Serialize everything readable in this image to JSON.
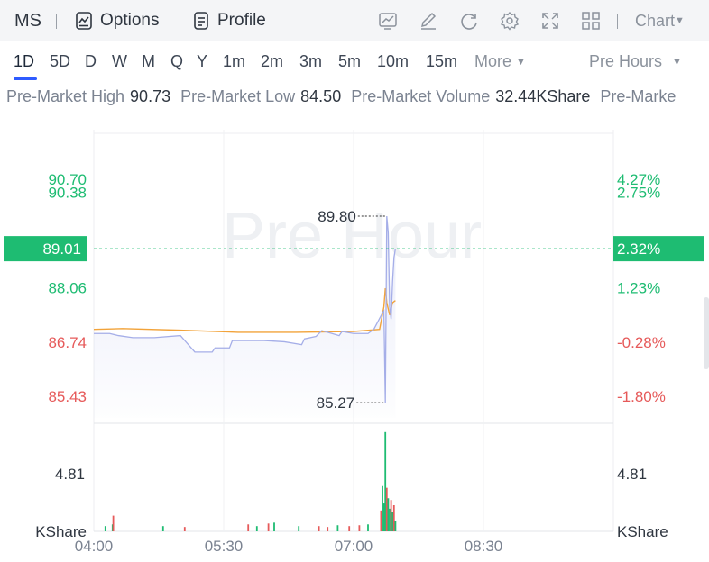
{
  "toolbar": {
    "symbol": "MS",
    "options_label": "Options",
    "profile_label": "Profile",
    "chart_label": "Chart",
    "icons": [
      "options-icon",
      "profile-icon",
      "indicator-icon",
      "draw-icon",
      "refresh-icon",
      "settings-icon",
      "fullscreen-icon",
      "layout-grid-icon"
    ]
  },
  "timeframes": {
    "items": [
      "1D",
      "5D",
      "D",
      "W",
      "M",
      "Q",
      "Y",
      "1m",
      "2m",
      "3m",
      "5m",
      "10m",
      "15m"
    ],
    "active": "1D",
    "more_label": "More",
    "session_label": "Pre Hours"
  },
  "stats": {
    "high_label": "Pre-Market High",
    "high_value": "90.73",
    "low_label": "Pre-Market Low",
    "low_value": "84.50",
    "volume_label": "Pre-Market Volume",
    "volume_value": "32.44KShare",
    "trailing_label": "Pre-Marke"
  },
  "chart_data": {
    "type": "line",
    "watermark": "Pre Hour",
    "x_ticks": [
      "04:00",
      "05:30",
      "07:00",
      "08:30"
    ],
    "price_ticks_left": [
      "90.70",
      "90.38",
      "88.06",
      "86.74",
      "85.43"
    ],
    "price_ticks_right": [
      "4.27%",
      "2.75%",
      "1.23%",
      "-0.28%",
      "-1.80%"
    ],
    "current_price": "89.01",
    "current_pct": "2.32%",
    "high_marker": "89.80",
    "low_marker": "85.27",
    "volume_tick": "4.81",
    "volume_unit": "KShare",
    "ylim": [
      84.9,
      91.9
    ],
    "prev_close": 86.98,
    "colors": {
      "up": "#1ebc72",
      "down": "#e65a5a",
      "price_line": "#a5aee8",
      "avg_line": "#f2a33a",
      "current": "#1ebc72"
    },
    "x_minutes_range": [
      240,
      600
    ],
    "price_series": [
      {
        "t": 240,
        "p": 86.95
      },
      {
        "t": 251,
        "p": 86.95
      },
      {
        "t": 257,
        "p": 86.9
      },
      {
        "t": 267,
        "p": 86.85
      },
      {
        "t": 282,
        "p": 86.85
      },
      {
        "t": 300,
        "p": 86.9
      },
      {
        "t": 310,
        "p": 86.5
      },
      {
        "t": 322,
        "p": 86.5
      },
      {
        "t": 324,
        "p": 86.6
      },
      {
        "t": 334,
        "p": 86.6
      },
      {
        "t": 336,
        "p": 86.78
      },
      {
        "t": 344,
        "p": 86.78
      },
      {
        "t": 358,
        "p": 86.78
      },
      {
        "t": 372,
        "p": 86.75
      },
      {
        "t": 384,
        "p": 86.68
      },
      {
        "t": 386,
        "p": 86.82
      },
      {
        "t": 394,
        "p": 86.88
      },
      {
        "t": 398,
        "p": 87.02
      },
      {
        "t": 405,
        "p": 86.95
      },
      {
        "t": 410,
        "p": 86.9
      },
      {
        "t": 412,
        "p": 87.0
      },
      {
        "t": 420,
        "p": 86.95
      },
      {
        "t": 430,
        "p": 86.95
      },
      {
        "t": 434,
        "p": 87.05
      },
      {
        "t": 437,
        "p": 87.25
      },
      {
        "t": 440,
        "p": 87.45
      },
      {
        "t": 441,
        "p": 87.5
      },
      {
        "t": 442,
        "p": 85.27
      },
      {
        "t": 443,
        "p": 89.8
      },
      {
        "t": 444,
        "p": 89.4
      },
      {
        "t": 445,
        "p": 87.6
      },
      {
        "t": 446,
        "p": 87.3
      },
      {
        "t": 447,
        "p": 88.2
      },
      {
        "t": 448,
        "p": 88.8
      },
      {
        "t": 449,
        "p": 89.01
      }
    ],
    "avg_series": [
      {
        "t": 240,
        "p": 87.05
      },
      {
        "t": 260,
        "p": 87.07
      },
      {
        "t": 300,
        "p": 87.03
      },
      {
        "t": 340,
        "p": 86.98
      },
      {
        "t": 380,
        "p": 86.98
      },
      {
        "t": 420,
        "p": 87.0
      },
      {
        "t": 438,
        "p": 87.05
      },
      {
        "t": 441,
        "p": 87.6
      },
      {
        "t": 442,
        "p": 88.05
      },
      {
        "t": 443,
        "p": 87.7
      },
      {
        "t": 445,
        "p": 87.4
      },
      {
        "t": 447,
        "p": 87.7
      },
      {
        "t": 449,
        "p": 87.75
      }
    ],
    "volume_series": [
      {
        "t": 248,
        "v": 0.3,
        "up": true
      },
      {
        "t": 253,
        "v": 0.4,
        "up": true
      },
      {
        "t": 253.5,
        "v": 0.9,
        "up": false
      },
      {
        "t": 288,
        "v": 0.3,
        "up": true
      },
      {
        "t": 303,
        "v": 0.25,
        "up": false
      },
      {
        "t": 347,
        "v": 0.4,
        "up": false
      },
      {
        "t": 353,
        "v": 0.3,
        "up": true
      },
      {
        "t": 361,
        "v": 0.45,
        "up": false
      },
      {
        "t": 365,
        "v": 0.5,
        "up": true
      },
      {
        "t": 382,
        "v": 0.3,
        "up": true
      },
      {
        "t": 396,
        "v": 0.3,
        "up": false
      },
      {
        "t": 402,
        "v": 0.25,
        "up": false
      },
      {
        "t": 409,
        "v": 0.35,
        "up": true
      },
      {
        "t": 417,
        "v": 0.3,
        "up": false
      },
      {
        "t": 424,
        "v": 0.35,
        "up": false
      },
      {
        "t": 430,
        "v": 0.4,
        "up": true
      },
      {
        "t": 439,
        "v": 1.2,
        "up": false
      },
      {
        "t": 440,
        "v": 2.6,
        "up": true
      },
      {
        "t": 441,
        "v": 1.6,
        "up": true
      },
      {
        "t": 442,
        "v": 5.7,
        "up": true
      },
      {
        "t": 443,
        "v": 2.5,
        "up": false
      },
      {
        "t": 444,
        "v": 1.9,
        "up": true
      },
      {
        "t": 445,
        "v": 1.3,
        "up": true
      },
      {
        "t": 446,
        "v": 1.8,
        "up": false
      },
      {
        "t": 447,
        "v": 1.1,
        "up": true
      },
      {
        "t": 448,
        "v": 1.5,
        "up": false
      },
      {
        "t": 449,
        "v": 0.6,
        "up": true
      }
    ]
  }
}
